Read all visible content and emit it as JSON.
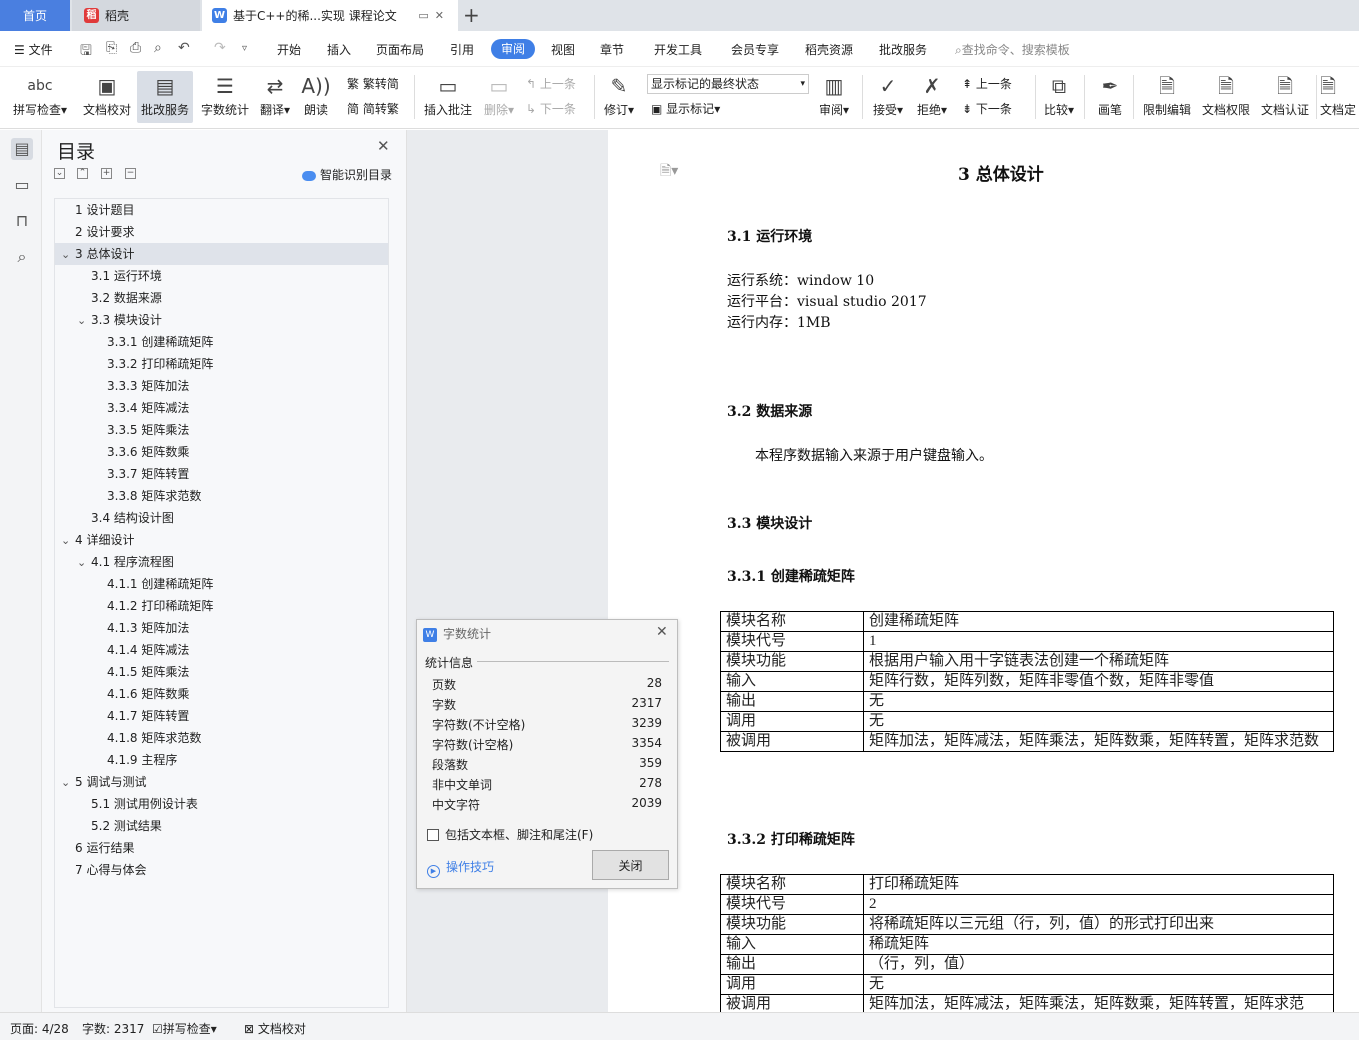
{
  "tabs": {
    "home": "首页",
    "daoke": "稻壳",
    "doc": "基于C++的稀...实现 课程论文"
  },
  "menu": {
    "file": "文件",
    "items": [
      "开始",
      "插入",
      "页面布局",
      "引用",
      "审阅",
      "视图",
      "章节",
      "开发工具",
      "会员专享",
      "稻壳资源",
      "批改服务"
    ],
    "search_placeholder": "查找命令、搜索模板"
  },
  "ribbon": {
    "spell_check": "拼写检查",
    "doc_proof": "文档校对",
    "review_service": "批改服务",
    "word_count": "字数统计",
    "translate": "翻译",
    "read_aloud": "朗读",
    "to_traditional": "繁转简",
    "to_simplified": "简转繁",
    "insert_comment": "插入批注",
    "delete": "删除",
    "prev_item": "上一条",
    "next_item": "下一条",
    "revise": "修订",
    "mark_state": "显示标记的最终状态",
    "show_marks": "显示标记",
    "review": "审阅",
    "accept": "接受",
    "reject": "拒绝",
    "prev_item2": "上一条",
    "next_item2": "下一条",
    "compare": "比较",
    "pen": "画笔",
    "restrict_edit": "限制编辑",
    "doc_rights": "文档权限",
    "doc_cert": "文档认证",
    "doc_final": "文档定"
  },
  "toc": {
    "title": "目录",
    "smart": "智能识别目录",
    "items": [
      {
        "label": "1  设计题目",
        "level": 1,
        "chev": ""
      },
      {
        "label": "2  设计要求",
        "level": 1,
        "chev": ""
      },
      {
        "label": "3  总体设计",
        "level": 1,
        "chev": "v",
        "active": true
      },
      {
        "label": "3.1  运行环境",
        "level": 2,
        "chev": ""
      },
      {
        "label": "3.2  数据来源",
        "level": 2,
        "chev": ""
      },
      {
        "label": "3.3  模块设计",
        "level": 2,
        "chev": "v"
      },
      {
        "label": "3.3.1  创建稀疏矩阵",
        "level": 3,
        "chev": ""
      },
      {
        "label": "3.3.2  打印稀疏矩阵",
        "level": 3,
        "chev": ""
      },
      {
        "label": "3.3.3  矩阵加法",
        "level": 3,
        "chev": ""
      },
      {
        "label": "3.3.4  矩阵减法",
        "level": 3,
        "chev": ""
      },
      {
        "label": "3.3.5  矩阵乘法",
        "level": 3,
        "chev": ""
      },
      {
        "label": "3.3.6  矩阵数乘",
        "level": 3,
        "chev": ""
      },
      {
        "label": "3.3.7  矩阵转置",
        "level": 3,
        "chev": ""
      },
      {
        "label": "3.3.8  矩阵求范数",
        "level": 3,
        "chev": ""
      },
      {
        "label": "3.4  结构设计图",
        "level": 2,
        "chev": ""
      },
      {
        "label": "4  详细设计",
        "level": 1,
        "chev": "v"
      },
      {
        "label": "4.1  程序流程图",
        "level": 2,
        "chev": "v"
      },
      {
        "label": "4.1.1  创建稀疏矩阵",
        "level": 3,
        "chev": ""
      },
      {
        "label": "4.1.2  打印稀疏矩阵",
        "level": 3,
        "chev": ""
      },
      {
        "label": "4.1.3  矩阵加法",
        "level": 3,
        "chev": ""
      },
      {
        "label": "4.1.4  矩阵减法",
        "level": 3,
        "chev": ""
      },
      {
        "label": "4.1.5  矩阵乘法",
        "level": 3,
        "chev": ""
      },
      {
        "label": "4.1.6  矩阵数乘",
        "level": 3,
        "chev": ""
      },
      {
        "label": "4.1.7  矩阵转置",
        "level": 3,
        "chev": ""
      },
      {
        "label": "4.1.8  矩阵求范数",
        "level": 3,
        "chev": ""
      },
      {
        "label": "4.1.9  主程序",
        "level": 3,
        "chev": ""
      },
      {
        "label": "5  调试与测试",
        "level": 1,
        "chev": "v"
      },
      {
        "label": "5.1  测试用例设计表",
        "level": 2,
        "chev": ""
      },
      {
        "label": "5.2  测试结果",
        "level": 2,
        "chev": ""
      },
      {
        "label": "6  运行结果",
        "level": 1,
        "chev": ""
      },
      {
        "label": "7  心得与体会",
        "level": 1,
        "chev": ""
      }
    ]
  },
  "document": {
    "h1": "3  总体设计",
    "s31": "3.1  运行环境",
    "env": [
      "运行系统：window 10",
      "运行平台：visual studio 2017",
      "运行内存：1MB"
    ],
    "s32": "3.2  数据来源",
    "data_src": "本程序数据输入来源于用户键盘输入。",
    "s33": "3.3  模块设计",
    "s331": "3.3.1  创建稀疏矩阵",
    "table1": [
      [
        "模块名称",
        "创建稀疏矩阵"
      ],
      [
        "模块代号",
        "1"
      ],
      [
        "模块功能",
        "根据用户输入用十字链表法创建一个稀疏矩阵"
      ],
      [
        "输入",
        "矩阵行数，矩阵列数，矩阵非零值个数，矩阵非零值"
      ],
      [
        "输出",
        "无"
      ],
      [
        "调用",
        "无"
      ],
      [
        "被调用",
        "矩阵加法，矩阵减法，矩阵乘法，矩阵数乘，矩阵转置，矩阵求范数"
      ]
    ],
    "s332": "3.3.2  打印稀疏矩阵",
    "table2": [
      [
        "模块名称",
        "打印稀疏矩阵"
      ],
      [
        "模块代号",
        "2"
      ],
      [
        "模块功能",
        "将稀疏矩阵以三元组（行，列，值）的形式打印出来"
      ],
      [
        "输入",
        "稀疏矩阵"
      ],
      [
        "输出",
        "（行，列，值）"
      ],
      [
        "调用",
        "无"
      ],
      [
        "被调用",
        "矩阵加法，矩阵减法，矩阵乘法，矩阵数乘，矩阵转置，矩阵求范"
      ]
    ]
  },
  "dialog": {
    "title": "字数统计",
    "section": "统计信息",
    "stats": [
      {
        "label": "页数",
        "value": "28"
      },
      {
        "label": "字数",
        "value": "2317"
      },
      {
        "label": "字符数(不计空格)",
        "value": "3239"
      },
      {
        "label": "字符数(计空格)",
        "value": "3354"
      },
      {
        "label": "段落数",
        "value": "359"
      },
      {
        "label": "非中文单词",
        "value": "278"
      },
      {
        "label": "中文字符",
        "value": "2039"
      }
    ],
    "checkbox": "包括文本框、脚注和尾注(F)",
    "tips": "操作技巧",
    "close": "关闭"
  },
  "status": {
    "page": "页面: 4/28",
    "words": "字数: 2317",
    "spell": "拼写检查",
    "proof": "文档校对"
  },
  "colors": {
    "accent": "#3f7fe6",
    "home_tab": "#4a7fe0"
  }
}
